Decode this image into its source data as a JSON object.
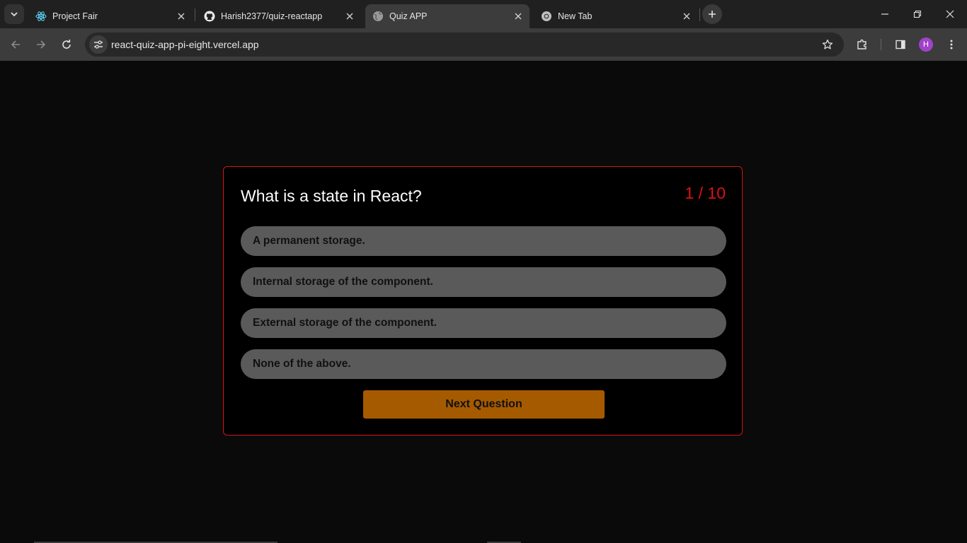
{
  "browser": {
    "tabs": [
      {
        "title": "Project Fair",
        "icon": "react-icon"
      },
      {
        "title": "Harish2377/quiz-reactapp",
        "icon": "github-icon"
      },
      {
        "title": "Quiz APP",
        "icon": "globe-icon",
        "active": true
      },
      {
        "title": "New Tab",
        "icon": "chrome-icon"
      }
    ],
    "url": "react-quiz-app-pi-eight.vercel.app",
    "profile_initial": "H"
  },
  "quiz": {
    "question": "What is a state in React?",
    "counter": "1 / 10",
    "options": [
      "A permanent storage.",
      "Internal storage of the component.",
      "External storage of the component.",
      "None of the above."
    ],
    "next_label": "Next Question"
  },
  "colors": {
    "card_border": "#d31616",
    "counter": "#e01010",
    "option_bg": "#5a5a5a",
    "next_button": "#a65a00"
  }
}
